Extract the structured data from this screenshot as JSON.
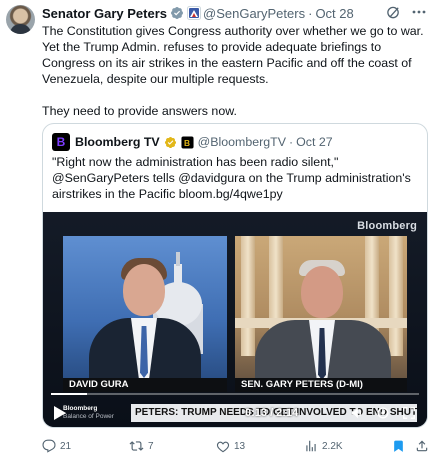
{
  "colors": {
    "accent": "#1d9bf0",
    "text_primary": "#0f1419",
    "text_secondary": "#536471",
    "border": "#cfd9de",
    "verified_gray": "#829aab",
    "bloomberg_purple": "#7d3cff",
    "gold_badge": "#e2b719"
  },
  "tweet": {
    "author_name": "Senator Gary Peters",
    "verified_icon": "government-verified-icon",
    "affiliation_icon": "us-senate-flag-icon",
    "handle": "@SenGaryPeters",
    "separator": "·",
    "date": "Oct 28",
    "header_actions": [
      "grok-icon",
      "more-icon"
    ],
    "paragraphs": [
      "The Constitution gives Congress authority over whether we go to war. Yet the Trump Admin. refuses to provide adequate briefings to Congress on its air strikes in the eastern Pacific and off the coast of Venezuela, despite our multiple requests.",
      "They need to provide answers now."
    ]
  },
  "quote": {
    "avatar_letter": "B",
    "author_name": "Bloomberg TV",
    "badge_icon": "gold-verified-icon",
    "affiliation_icon": "bloomberg-affiliate-icon",
    "handle": "@BloombergTV",
    "separator": "·",
    "date": "Oct 27",
    "text": "\"Right now the administration has been radio silent,\" @SenGaryPeters tells @davidgura on the Trump administration's airstrikes in the Pacific bloom.bg/4qwe1py"
  },
  "video": {
    "watermark": "Bloomberg",
    "name_left": "DAVID GURA",
    "name_right": "SEN. GARY PETERS (D-MI)",
    "ticker_brand_line1": "Bloomberg",
    "ticker_brand_line2": "Balance of Power",
    "ticker_text": "PETERS: TRUMP NEEDS TO GET INVOLVED TO END SHUTDOWN",
    "time": "0:13 / 2:14",
    "progress": 0.097,
    "controls": [
      "play-icon",
      "volume-icon",
      "settings-icon",
      "fullscreen-icon"
    ]
  },
  "actions": {
    "reply_count": "21",
    "retweet_count": "7",
    "like_count": "13",
    "views_count": "2.2K"
  }
}
